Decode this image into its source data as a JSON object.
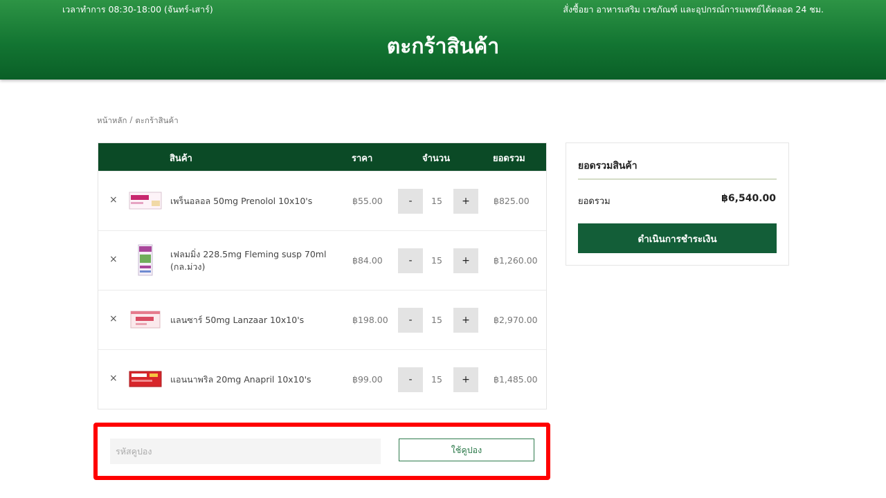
{
  "header": {
    "hours": "เวลาทำการ 08:30-18:00 (จันทร์-เสาร์)",
    "tagline": "สั่งซื้อยา อาหารเสริม เวชภัณฑ์ และอุปกรณ์การแพทย์ได้ตลอด 24 ชม.",
    "title": "ตะกร้าสินค้า"
  },
  "breadcrumb": {
    "home": "หน้าหลัก",
    "separator": "/",
    "current": "ตะกร้าสินค้า"
  },
  "cart": {
    "columns": {
      "product": "สินค้า",
      "price": "ราคา",
      "quantity": "จำนวน",
      "subtotal": "ยอดรวม"
    },
    "items": [
      {
        "name": "เพร็นอลอล 50mg Prenolol 10x10's",
        "price": "฿55.00",
        "quantity": "15",
        "subtotal": "฿825.00",
        "remove": "×",
        "minus": "-",
        "plus": "+"
      },
      {
        "name": "เฟลมมิ่ง 228.5mg Fleming susp 70ml (กล.ม่วง)",
        "price": "฿84.00",
        "quantity": "15",
        "subtotal": "฿1,260.00",
        "remove": "×",
        "minus": "-",
        "plus": "+"
      },
      {
        "name": "แลนซาร์ 50mg Lanzaar 10x10's",
        "price": "฿198.00",
        "quantity": "15",
        "subtotal": "฿2,970.00",
        "remove": "×",
        "minus": "-",
        "plus": "+"
      },
      {
        "name": "แอนนาพริล 20mg Anapril 10x10's",
        "price": "฿99.00",
        "quantity": "15",
        "subtotal": "฿1,485.00",
        "remove": "×",
        "minus": "-",
        "plus": "+"
      }
    ]
  },
  "coupon": {
    "placeholder": "รหัสคูปอง",
    "apply_label": "ใช้คูปอง"
  },
  "summary": {
    "title": "ยอดรวมสินค้า",
    "total_label": "ยอดรวม",
    "total_value": "฿6,540.00",
    "checkout_label": "ดำเนินการชำระเงิน"
  },
  "colors": {
    "brand_green": "#137532",
    "table_header": "#0b4a26",
    "checkout_button": "#135e38",
    "highlight": "#ff0000"
  }
}
